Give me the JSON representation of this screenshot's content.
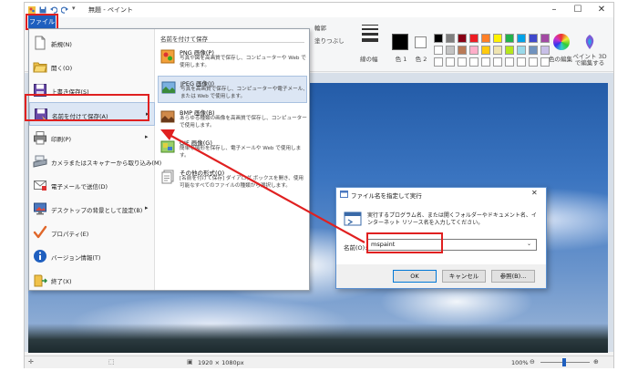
{
  "window": {
    "title": "無題 - ペイント",
    "controls": [
      "–",
      "☐",
      "✕"
    ]
  },
  "ribbon": {
    "file_tab": "ファイル",
    "outline_label": "輪郭",
    "fill_label": "塗りつぶし",
    "line_width_label": "線の幅",
    "color1_label": "色 1",
    "color2_label": "色 2",
    "edit_colors_label": "色の編集",
    "paint3d_label": "ペイント 3D で編集する",
    "palette": [
      "#000000",
      "#7f7f7f",
      "#880015",
      "#ed1c24",
      "#ff7f27",
      "#fff200",
      "#22b14c",
      "#00a2e8",
      "#3f48cc",
      "#a349a4",
      "#ffffff",
      "#c3c3c3",
      "#b97a57",
      "#ffaec9",
      "#ffc90e",
      "#efe4b0",
      "#b5e61d",
      "#99d9ea",
      "#7092be",
      "#c8bfe7",
      "#ffffff",
      "#ffffff",
      "#ffffff",
      "#ffffff",
      "#ffffff",
      "#ffffff",
      "#ffffff",
      "#ffffff",
      "#ffffff",
      "#ffffff"
    ]
  },
  "file_menu": {
    "items": [
      {
        "label": "新規(N)",
        "icon": "new-file-icon",
        "arrow": ""
      },
      {
        "label": "開く(O)",
        "icon": "open-folder-icon",
        "arrow": ""
      },
      {
        "label": "上書き保存(S)",
        "icon": "save-icon",
        "arrow": ""
      },
      {
        "label": "名前を付けて保存(A)",
        "icon": "save-as-icon",
        "arrow": "▸"
      },
      {
        "label": "印刷(P)",
        "icon": "print-icon",
        "arrow": "▸"
      },
      {
        "label": "カメラまたはスキャナーから取り込み(M)",
        "icon": "scanner-icon",
        "arrow": ""
      },
      {
        "label": "電子メールで送信(D)",
        "icon": "email-icon",
        "arrow": ""
      },
      {
        "label": "デスクトップの背景として設定(B)",
        "icon": "desktop-background-icon",
        "arrow": "▸"
      },
      {
        "label": "プロパティ(E)",
        "icon": "properties-checkmark-icon",
        "arrow": ""
      },
      {
        "label": "バージョン情報(T)",
        "icon": "info-icon",
        "arrow": ""
      },
      {
        "label": "終了(X)",
        "icon": "exit-icon",
        "arrow": ""
      }
    ],
    "submenu": {
      "header": "名前を付けて保存",
      "items": [
        {
          "title": "PNG 画像(P)",
          "desc": "写真や図を高画質で保存し、コンピューターや Web で使用します。",
          "icon": "png-image-icon"
        },
        {
          "title": "JPEG 画像(J)",
          "desc": "写真を高画質で保存し、コンピューターや電子メール、または Web で使用します。",
          "icon": "jpeg-image-icon"
        },
        {
          "title": "BMP 画像(B)",
          "desc": "あらゆる種類の画像を高画質で保存し、コンピューターで使用します。",
          "icon": "bmp-image-icon"
        },
        {
          "title": "GIF 画像(G)",
          "desc": "簡単な図形を保存し、電子メールや Web で使用します。",
          "icon": "gif-image-icon"
        },
        {
          "title": "その他の形式(O)",
          "desc": "[名前を付けて保存] ダイアログ ボックスを開き、使用可能なすべてのファイルの種類から選択します。",
          "icon": "other-formats-icon"
        }
      ]
    }
  },
  "run_dialog": {
    "title": "ファイル名を指定して実行",
    "description": "実行するプログラム名、または開くフォルダーやドキュメント名、インターネット リソース名を入力してください。",
    "name_label": "名前(O):",
    "input_value": "mspaint",
    "ok_label": "OK",
    "cancel_label": "キャンセル",
    "browse_label": "参照(B)..."
  },
  "status_bar": {
    "dimensions": "1920 × 1080px",
    "zoom": "100%"
  }
}
